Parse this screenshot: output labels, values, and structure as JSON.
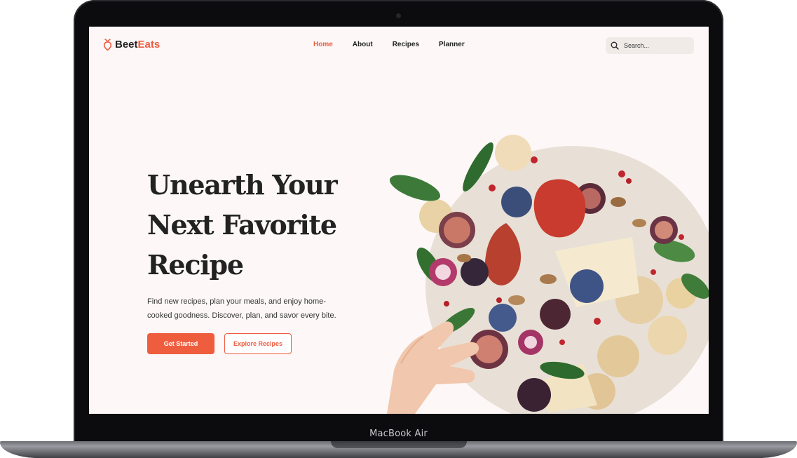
{
  "device": {
    "label": "MacBook Air"
  },
  "brand": {
    "name_part1": "Beet",
    "name_part2": "Eats",
    "accent_color": "#ee5b3f"
  },
  "nav": {
    "items": [
      {
        "label": "Home",
        "active": true
      },
      {
        "label": "About",
        "active": false
      },
      {
        "label": "Recipes",
        "active": false
      },
      {
        "label": "Planner",
        "active": false
      }
    ]
  },
  "search": {
    "placeholder": "Search...",
    "icon": "search-icon"
  },
  "hero": {
    "title_line1": "Unearth Your",
    "title_line2": "Next Favorite",
    "title_line3": "Recipe",
    "subtitle": "Find new recipes, plan your meals, and enjoy home-cooked goodness. Discover, plan, and savor every bite.",
    "primary_button": "Get Started",
    "secondary_button": "Explore Recipes"
  },
  "colors": {
    "page_bg": "#fdf8f7",
    "accent": "#ee5b3f",
    "text": "#222222"
  }
}
